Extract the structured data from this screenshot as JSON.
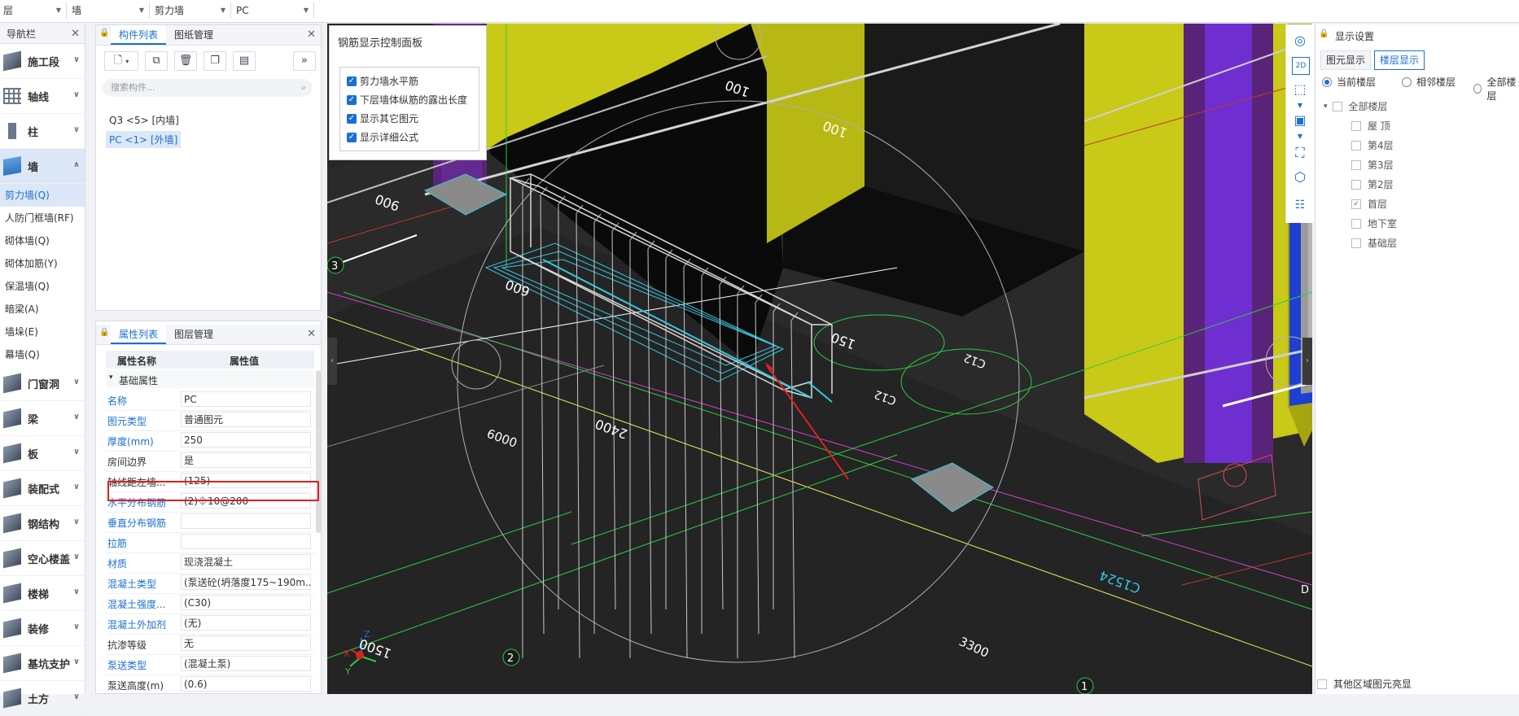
{
  "toolbar": {
    "combos": [
      "层",
      "墙",
      "剪力墙",
      "PC"
    ]
  },
  "nav": {
    "title": "导航栏",
    "cats_top": [
      "施工段",
      "轴线",
      "柱",
      "墙"
    ],
    "wall_subs": [
      "剪力墙(Q)",
      "人防门框墙(RF)",
      "砌体墙(Q)",
      "砌体加筋(Y)",
      "保温墙(Q)",
      "暗梁(A)",
      "墙垛(E)",
      "幕墙(Q)"
    ],
    "cats_bottom": [
      "门窗洞",
      "梁",
      "板",
      "装配式",
      "钢结构",
      "空心楼盖",
      "楼梯",
      "装修",
      "基坑支护",
      "土方"
    ]
  },
  "component_panel": {
    "tabs": [
      "构件列表",
      "图纸管理"
    ],
    "search_placeholder": "搜索构件...",
    "items": [
      "Q3 <5> [内墙]",
      "PC <1> [外墙]"
    ]
  },
  "property_panel": {
    "tabs": [
      "属性列表",
      "图层管理"
    ],
    "col_name": "属性名称",
    "col_value": "属性值",
    "group": "基础属性",
    "rows": [
      {
        "name": "名称",
        "value": "PC"
      },
      {
        "name": "图元类型",
        "value": "普通图元"
      },
      {
        "name": "厚度(mm)",
        "value": "250"
      },
      {
        "name": "房间边界",
        "value": "是"
      },
      {
        "name": "轴线距左墙...",
        "value": "(125)"
      },
      {
        "name": "水平分布钢筋",
        "value": "(2)⏀10@200"
      },
      {
        "name": "垂直分布钢筋",
        "value": ""
      },
      {
        "name": "拉筋",
        "value": ""
      },
      {
        "name": "材质",
        "value": "现浇混凝土"
      },
      {
        "name": "混凝土类型",
        "value": "(泵送砼(坍落度175~190m..."
      },
      {
        "name": "混凝土强度...",
        "value": "(C30)"
      },
      {
        "name": "混凝土外加剂",
        "value": "(无)"
      },
      {
        "name": "抗渗等级",
        "value": "无"
      },
      {
        "name": "泵送类型",
        "value": "(混凝土泵)"
      },
      {
        "name": "泵送高度(m)",
        "value": "(0.6)"
      }
    ]
  },
  "rebar_panel": {
    "title": "钢筋显示控制面板",
    "options": [
      "剪力墙水平筋",
      "下层墙体纵筋的露出长度",
      "显示其它图元",
      "显示详细公式"
    ]
  },
  "viewport": {
    "labels": {
      "dim_6000": "6000",
      "dim_3300": "3300",
      "dim_1500": "1500",
      "dim_100a": "100",
      "dim_100b": "100",
      "dim_900": "900",
      "dim_600": "600",
      "dim_2400": "2400",
      "dim_150": "150",
      "dim_c1524": "C1524",
      "axis_3": "3",
      "axis_2": "2",
      "axis_1": "1",
      "axis_d": "D",
      "c12a": "C12",
      "c12b": "C12",
      "axis_x": "X",
      "axis_y": "Y",
      "axis_z": "Z"
    }
  },
  "view_tools": {
    "label_2d": "2D"
  },
  "display_panel": {
    "title": "显示设置",
    "tabs": [
      "图元显示",
      "楼层显示"
    ],
    "radios": [
      "当前楼层",
      "相邻楼层",
      "全部楼层"
    ],
    "tree_root": "全部楼层",
    "floors": [
      "屋 顶",
      "第4层",
      "第3层",
      "第2层",
      "首层",
      "地下室",
      "基础层"
    ],
    "footer": "其他区域图元亮显"
  },
  "colors": {
    "accent": "#1a6fd4",
    "selected_bg": "#dce8f7",
    "yellow_wall": "#c8c814",
    "purple_col": "#5a237a",
    "highlight_box": "#e02020"
  }
}
